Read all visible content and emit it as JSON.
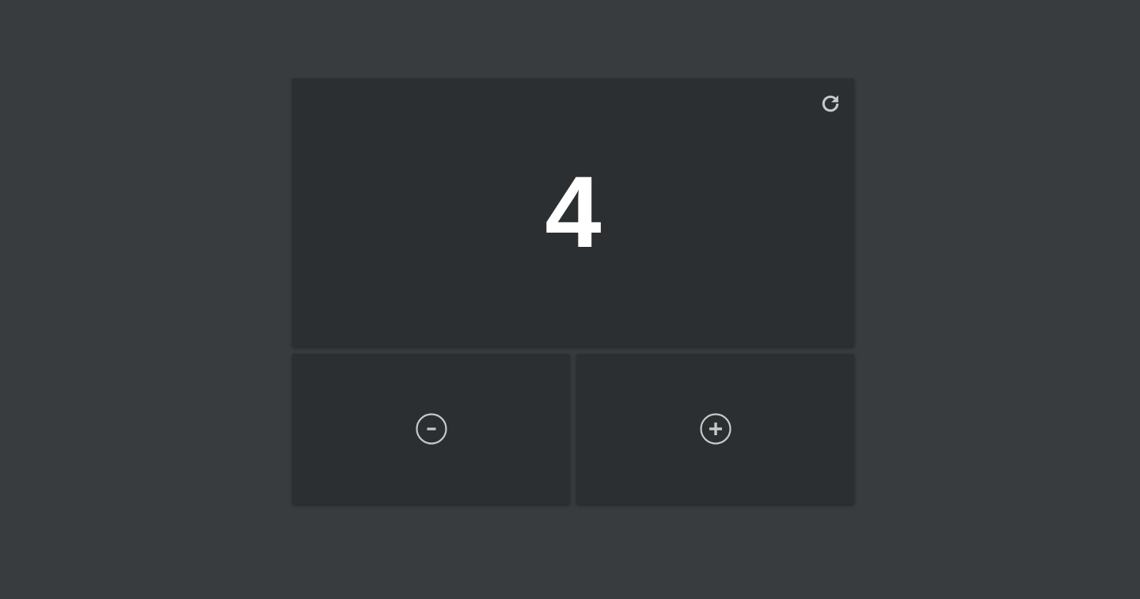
{
  "counter": {
    "value": "4"
  },
  "controls": {
    "reset_icon": "refresh-icon",
    "decrement_icon": "minus-circle-icon",
    "increment_icon": "plus-circle-icon"
  },
  "colors": {
    "background": "#383c3f",
    "panel": "#2c2f31",
    "text": "#ffffff",
    "icon": "#c8c8c8"
  }
}
